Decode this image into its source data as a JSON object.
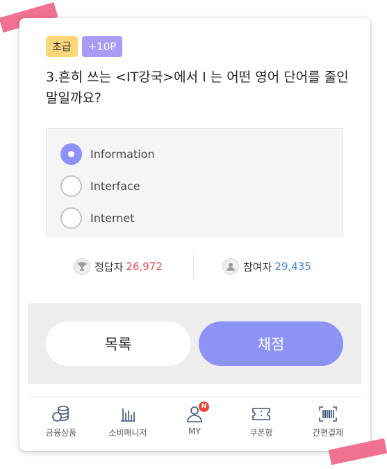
{
  "quiz": {
    "level_badge": "초급",
    "point_badge": "+10P",
    "question": "3.흔히 쓰는 <IT강국>에서 I 는 어떤 영어 단어를 줄인 말일까요?",
    "options": [
      {
        "label": "Information",
        "selected": true
      },
      {
        "label": "Interface",
        "selected": false
      },
      {
        "label": "Internet",
        "selected": false
      }
    ]
  },
  "stats": {
    "correct_label": "정답자",
    "correct_count": "26,972",
    "participants_label": "참여자",
    "participants_count": "29,435"
  },
  "actions": {
    "list_label": "목록",
    "grade_label": "채점"
  },
  "bottom_nav": {
    "items": [
      {
        "label": "금융상품",
        "icon": "coins-icon"
      },
      {
        "label": "소비매니저",
        "icon": "bar-chart-icon"
      },
      {
        "label": "MY",
        "icon": "person-icon",
        "badge": "N"
      },
      {
        "label": "쿠폰함",
        "icon": "ticket-icon"
      },
      {
        "label": "간편결제",
        "icon": "barcode-icon"
      }
    ]
  },
  "colors": {
    "accent": "#8d92f5",
    "correct_count": "#e0525a",
    "participants_count": "#4a88d0",
    "level_badge": "#fcd77a",
    "point_badge": "#a79bf6",
    "tape": "#f06a8a"
  }
}
